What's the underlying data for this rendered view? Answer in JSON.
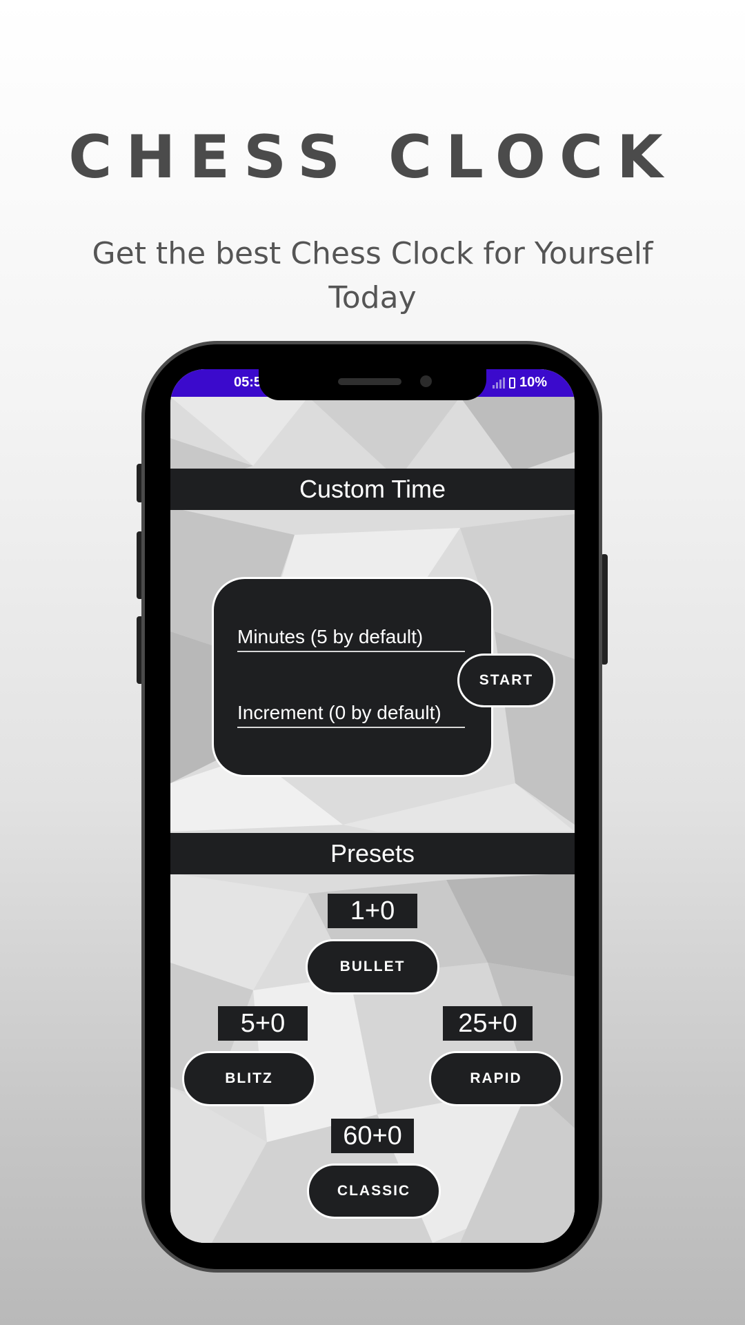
{
  "promo": {
    "headline": "CHESS CLOCK",
    "subline": "Get the best Chess Clock for Yourself Today"
  },
  "status_bar": {
    "time": "05:5",
    "battery": "10%",
    "color": "#3b0acc"
  },
  "custom_time": {
    "title": "Custom Time",
    "minutes_placeholder": "Minutes (5 by default)",
    "increment_placeholder": "Increment (0 by default)",
    "start_label": "START"
  },
  "presets": {
    "title": "Presets",
    "items": [
      {
        "time": "1+0",
        "label": "BULLET"
      },
      {
        "time": "5+0",
        "label": "BLITZ"
      },
      {
        "time": "25+0",
        "label": "RAPID"
      },
      {
        "time": "60+0",
        "label": "CLASSIC"
      }
    ]
  },
  "colors": {
    "dark_panel": "#1e1f21",
    "headline_text": "#4b4b4b"
  }
}
